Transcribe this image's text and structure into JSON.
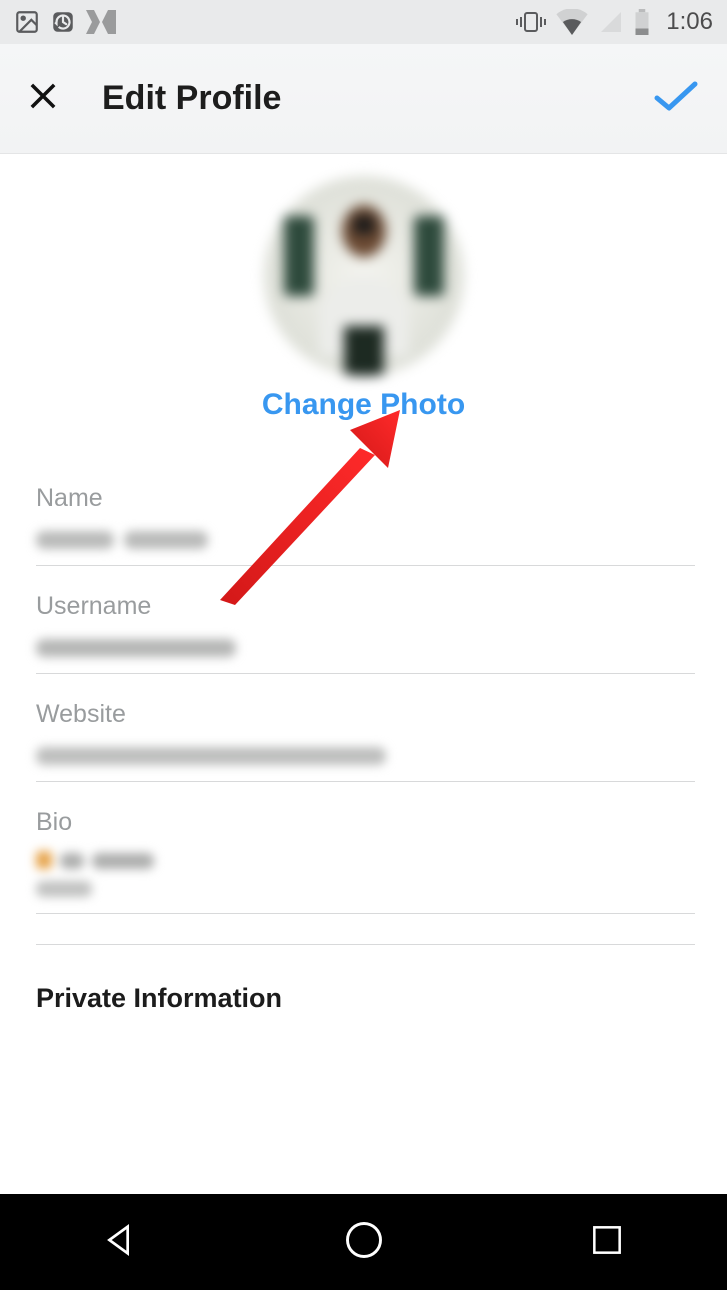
{
  "statusbar": {
    "time": "1:06"
  },
  "header": {
    "title": "Edit Profile"
  },
  "change_photo_label": "Change Photo",
  "fields": {
    "name": {
      "label": "Name"
    },
    "username": {
      "label": "Username"
    },
    "website": {
      "label": "Website"
    },
    "bio": {
      "label": "Bio"
    }
  },
  "section": {
    "private_info": "Private Information"
  },
  "accent_color": "#3897f0"
}
